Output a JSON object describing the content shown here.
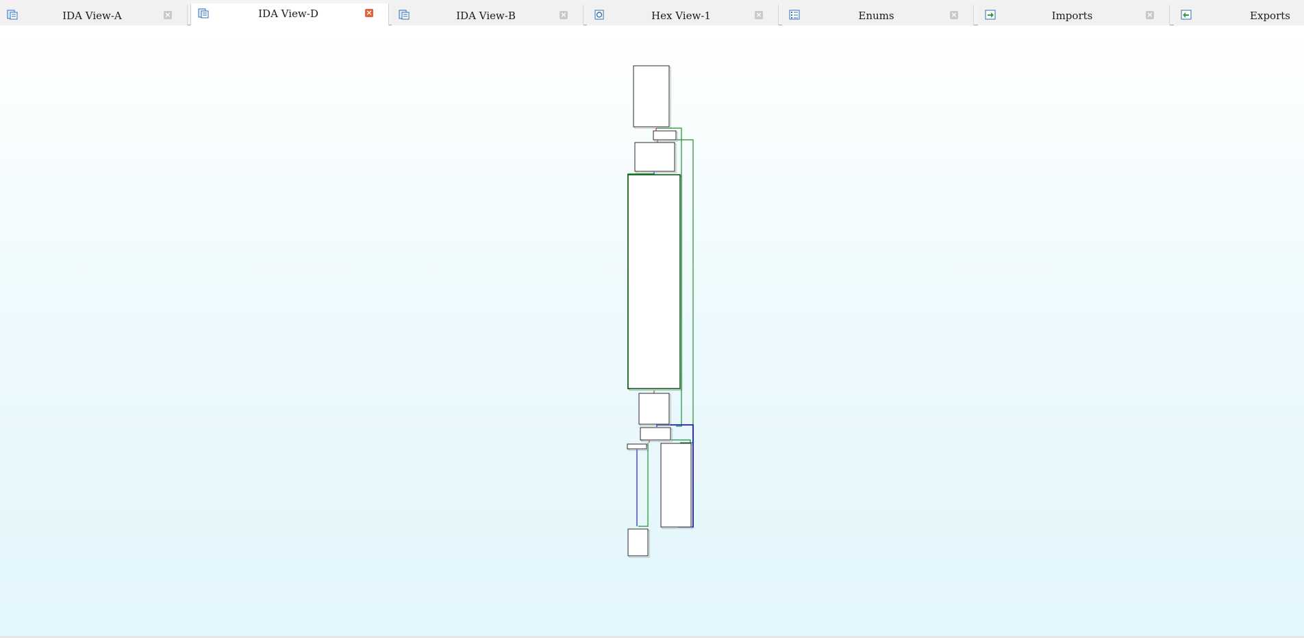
{
  "tabs": [
    {
      "label": "IDA View-A",
      "icon": "disassembly-view-icon",
      "active": false,
      "close": "×"
    },
    {
      "label": "IDA View-D",
      "icon": "disassembly-view-icon",
      "active": true,
      "close": "×"
    },
    {
      "label": "IDA View-B",
      "icon": "disassembly-view-icon",
      "active": false,
      "close": "×"
    },
    {
      "label": "Hex View-1",
      "icon": "hex-view-icon",
      "active": false,
      "close": "×"
    },
    {
      "label": "Enums",
      "icon": "enums-icon",
      "active": false,
      "close": "×"
    },
    {
      "label": "Imports",
      "icon": "imports-icon",
      "active": false,
      "close": "×"
    },
    {
      "label": "Exports",
      "icon": "exports-icon",
      "active": false,
      "close": ""
    }
  ],
  "colors": {
    "edge_true": "#1f8f2f",
    "edge_false": "#d23232",
    "edge_uncond": "#1a1acc",
    "node_border": "#2a2a2a",
    "node_fill": "#ffffff",
    "active_close": "#e0633a"
  }
}
